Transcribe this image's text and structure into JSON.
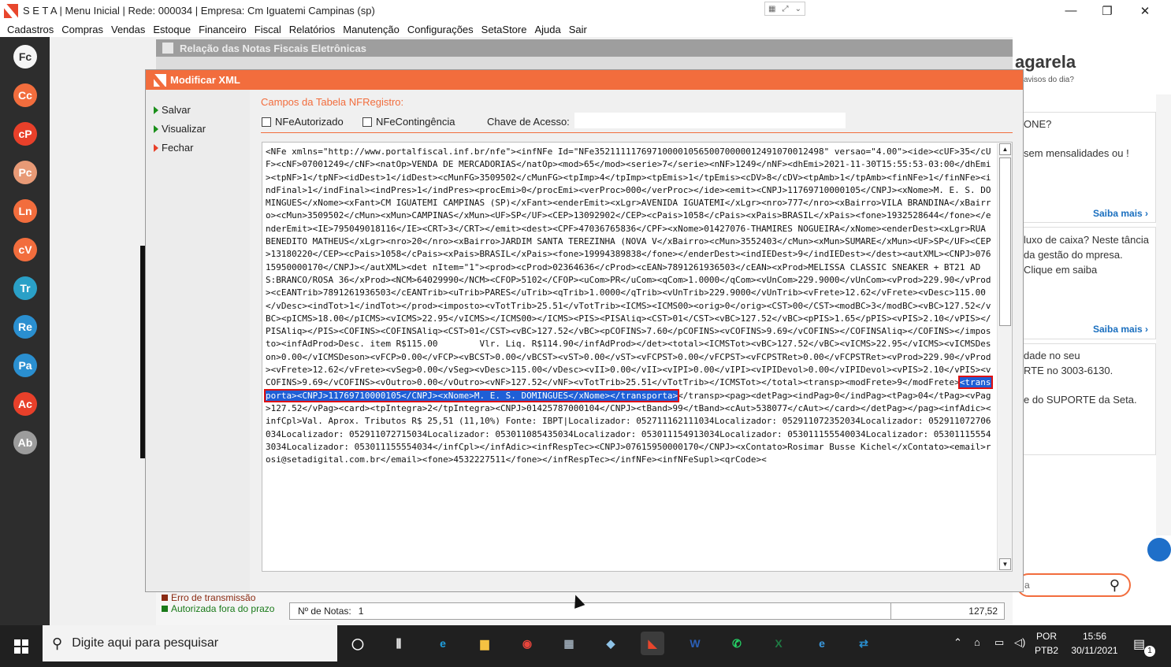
{
  "window": {
    "title": "S E T A | Menu Inicial | Rede: 000034 | Empresa: Cm Iguatemi Campinas (sp)",
    "minimize_glyph": "—",
    "restore_glyph": "❐",
    "close_glyph": "✕"
  },
  "menu": [
    "Cadastros",
    "Compras",
    "Vendas",
    "Estoque",
    "Financeiro",
    "Fiscal",
    "Relatórios",
    "Manutenção",
    "Configurações",
    "SetaStore",
    "Ajuda",
    "Sair"
  ],
  "launcher": [
    {
      "label": "Fc",
      "color": "#f5f5f5",
      "text": "#333333"
    },
    {
      "label": "Cc",
      "color": "#f26d3d",
      "text": "#ffffff"
    },
    {
      "label": "cP",
      "color": "#e8402a",
      "text": "#ffffff"
    },
    {
      "label": "Pc",
      "color": "#e89a76",
      "text": "#ffffff"
    },
    {
      "label": "Ln",
      "color": "#f26d3d",
      "text": "#ffffff"
    },
    {
      "label": "cV",
      "color": "#f26d3d",
      "text": "#ffffff"
    },
    {
      "label": "Tr",
      "color": "#2aa0c7",
      "text": "#ffffff"
    },
    {
      "label": "Re",
      "color": "#2a8fd0",
      "text": "#ffffff"
    },
    {
      "label": "Pa",
      "color": "#2a8fd0",
      "text": "#ffffff"
    },
    {
      "label": "Ac",
      "color": "#e8402a",
      "text": "#ffffff"
    },
    {
      "label": "Ab",
      "color": "#9c9c9c",
      "text": "#ffffff"
    }
  ],
  "background_window": {
    "title": "Relação das Notas Fiscais Eletrônicas",
    "legend_error": "Erro de transmissão",
    "legend_authorized": "Autorizada fora do prazo",
    "count_label": "Nº de Notas:",
    "count_value": "1",
    "total": "127,52"
  },
  "modal": {
    "title": "Modificar XML",
    "actions": [
      "Salvar",
      "Visualizar",
      "Fechar"
    ],
    "section_title": "Campos da Tabela NFRegistro:",
    "checkbox_authorized": "NFeAutorizado",
    "checkbox_contingency": "NFeContingência",
    "key_label": "Chave de Acesso:",
    "key_value": "",
    "xml_before": "<NFe xmlns=\"http://www.portalfiscal.inf.br/nfe\"><infNFe Id=\"NFe35211111769710000105650070000012491070012498\" versao=\"4.00\"><ide><cUF>35</cUF><cNF>07001249</cNF><natOp>VENDA DE MERCADORIAS</natOp><mod>65</mod><serie>7</serie><nNF>1249</nNF><dhEmi>2021-11-30T15:55:53-03:00</dhEmi><tpNF>1</tpNF><idDest>1</idDest><cMunFG>3509502</cMunFG><tpImp>4</tpImp><tpEmis>1</tpEmis><cDV>8</cDV><tpAmb>1</tpAmb><finNFe>1</finNFe><indFinal>1</indFinal><indPres>1</indPres><procEmi>0</procEmi><verProc>000</verProc></ide><emit><CNPJ>11769710000105</CNPJ><xNome>M. E. S. DOMINGUES</xNome><xFant>CM IGUATEMI CAMPINAS (SP)</xFant><enderEmit><xLgr>AVENIDA IGUATEMI</xLgr><nro>777</nro><xBairro>VILA BRANDINA</xBairro><cMun>3509502</cMun><xMun>CAMPINAS</xMun><UF>SP</UF><CEP>13092902</CEP><cPais>1058</cPais><xPais>BRASIL</xPais><fone>1932528644</fone></enderEmit><IE>795049018116</IE><CRT>3</CRT></emit><dest><CPF>47036765836</CPF><xNome>01427076-THAMIRES NOGUEIRA</xNome><enderDest><xLgr>RUA BENEDITO MATHEUS</xLgr><nro>20</nro><xBairro>JARDIM SANTA TEREZINHA (NOVA V</xBairro><cMun>3552403</cMun><xMun>SUMARE</xMun><UF>SP</UF><CEP>13180220</CEP><cPais>1058</cPais><xPais>BRASIL</xPais><fone>19994389838</fone></enderDest><indIEDest>9</indIEDest></dest><autXML><CNPJ>07615950000170</CNPJ></autXML><det nItem=\"1\"><prod><cProd>02364636</cProd><cEAN>7891261936503</cEAN><xProd>MELISSA CLASSIC SNEAKER + BT21 AD S:BRANCO/ROSA 36</xProd><NCM>64029990</NCM><CFOP>5102</CFOP><uCom>PR</uCom><qCom>1.0000</qCom><vUnCom>229.9000</vUnCom><vProd>229.90</vProd><cEANTrib>7891261936503</cEANTrib><uTrib>PARES</uTrib><qTrib>1.0000</qTrib><vUnTrib>229.9000</vUnTrib><vFrete>12.62</vFrete><vDesc>115.00</vDesc><indTot>1</indTot></prod><imposto><vTotTrib>25.51</vTotTrib><ICMS><ICMS00><orig>0</orig><CST>00</CST><modBC>3</modBC><vBC>127.52</vBC><pICMS>18.00</pICMS><vICMS>22.95</vICMS></ICMS00></ICMS><PIS><PISAliq><CST>01</CST><vBC>127.52</vBC><pPIS>1.65</pPIS><vPIS>2.10</vPIS></PISAliq></PIS><COFINS><COFINSAliq><CST>01</CST><vBC>127.52</vBC><pCOFINS>7.60</pCOFINS><vCOFINS>9.69</vCOFINS></COFINSAliq></COFINS></imposto><infAdProd>Desc. item R$115.00        Vlr. Liq. R$114.90</infAdProd></det><total><ICMSTot><vBC>127.52</vBC><vICMS>22.95</vICMS><vICMSDeson>0.00</vICMSDeson><vFCP>0.00</vFCP><vBCST>0.00</vBCST><vST>0.00</vST><vFCPST>0.00</vFCPST><vFCPSTRet>0.00</vFCPSTRet><vProd>229.90</vProd><vFrete>12.62</vFrete><vSeg>0.00</vSeg><vDesc>115.00</vDesc><vII>0.00</vII><vIPI>0.00</vIPI><vIPIDevol>0.00</vIPIDevol><vPIS>2.10</vPIS><vCOFINS>9.69</vCOFINS><vOutro>0.00</vOutro><vNF>127.52</vNF><vTotTrib>25.51</vTotTrib></ICMSTot></total><transp><modFrete>9</modFrete>",
    "xml_selected": "<transporta><CNPJ>11769710000105</CNPJ><xNome>M. E. S. DOMINGUES</xNome></transporta>",
    "xml_after": "</transp><pag><detPag><indPag>0</indPag><tPag>04</tPag><vPag>127.52</vPag><card><tpIntegra>2</tpIntegra><CNPJ>01425787000104</CNPJ><tBand>99</tBand><cAut>538077</cAut></card></detPag></pag><infAdic><infCpl>Val. Aprox. Tributos R$ 25,51 (11,10%) Fonte: IBPT|Localizador: 052711162111034Localizador: 052911072352034Localizador: 052911072706034Localizador: 052911072715034Localizador: 053011085435034Localizador: 053011154913034Localizador: 053011155540034Localizador: 053011155543034Localizador: 053011155554034</infCpl></infAdic><infRespTec><CNPJ>07615950000170</CNPJ><xContato>Rosimar Busse Kichel</xContato><email>rosi@setadigital.com.br</email><fone>4532227511</fone></infRespTec></infNFe><infNFeSupl><qrCode><"
  },
  "promo": {
    "brand": "agarela",
    "brand_sub": "avisos do dia?",
    "card1_title": "ONE?",
    "card1_body": "sem mensalidades ou !",
    "card1_link": "Saiba mais ›",
    "card2_body": "luxo de caixa?  Neste tância da gestão do mpresa. Clique em saiba",
    "card2_link": "Saiba mais ›",
    "card3_l1": "dade no seu",
    "card3_l2": "RTE no 3003-6130.",
    "card3_l3": "e do SUPORTE da Seta.",
    "search_text": "a"
  },
  "taskbar": {
    "search_placeholder": "Digite aqui para pesquisar",
    "apps": [
      {
        "name": "task-view-icon",
        "glyph": "◯",
        "color": "#ffffff"
      },
      {
        "name": "timeline-icon",
        "glyph": "⫼",
        "color": "#ffffff"
      },
      {
        "name": "edge-icon",
        "glyph": "e",
        "color": "#1fa0e0"
      },
      {
        "name": "file-explorer-icon",
        "glyph": "▆",
        "color": "#f5c242"
      },
      {
        "name": "chrome-icon",
        "glyph": "◉",
        "color": "#e8453c"
      },
      {
        "name": "calculator-icon",
        "glyph": "▦",
        "color": "#9aa7b3"
      },
      {
        "name": "notes-icon",
        "glyph": "◆",
        "color": "#8fc4e8"
      },
      {
        "name": "seta-app-icon",
        "glyph": "◣",
        "color": "#e8462c"
      },
      {
        "name": "word-icon",
        "glyph": "W",
        "color": "#2b5fb6"
      },
      {
        "name": "whatsapp-icon",
        "glyph": "✆",
        "color": "#25d366"
      },
      {
        "name": "excel-icon",
        "glyph": "X",
        "color": "#1f7a43"
      },
      {
        "name": "internet-explorer-icon",
        "glyph": "e",
        "color": "#3a9ae0"
      },
      {
        "name": "teamviewer-icon",
        "glyph": "⇄",
        "color": "#2a8fd0"
      }
    ],
    "language_top": "POR",
    "language_bottom": "PTB2",
    "time": "15:56",
    "date": "30/11/2021",
    "notification_count": "1"
  }
}
